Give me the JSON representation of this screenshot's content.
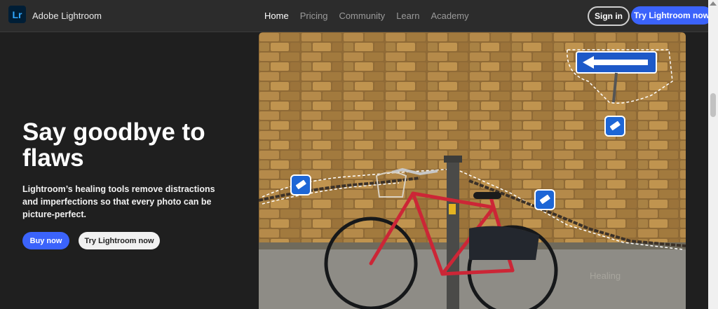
{
  "header": {
    "logo_text": "Lr",
    "brand": "Adobe Lightroom",
    "nav": [
      "Home",
      "Pricing",
      "Community",
      "Learn",
      "Academy"
    ],
    "active_nav": "Home",
    "signin_label": "Sign in",
    "try_label": "Try Lightroom now"
  },
  "hero": {
    "title": "Say goodbye to flaws",
    "description": "Lightroom’s healing tools remove distractions and imperfections so that every photo can be picture-perfect.",
    "buy_label": "Buy now",
    "try_label": "Try Lightroom now"
  },
  "photo": {
    "icons": [
      "eraser-icon",
      "eraser-icon",
      "eraser-icon"
    ]
  },
  "colors": {
    "accent": "#3b63fb",
    "background": "#1f1f1f",
    "header_bg": "#2c2c2c",
    "logo_bg": "#001e36",
    "logo_fg": "#31a8ff"
  }
}
